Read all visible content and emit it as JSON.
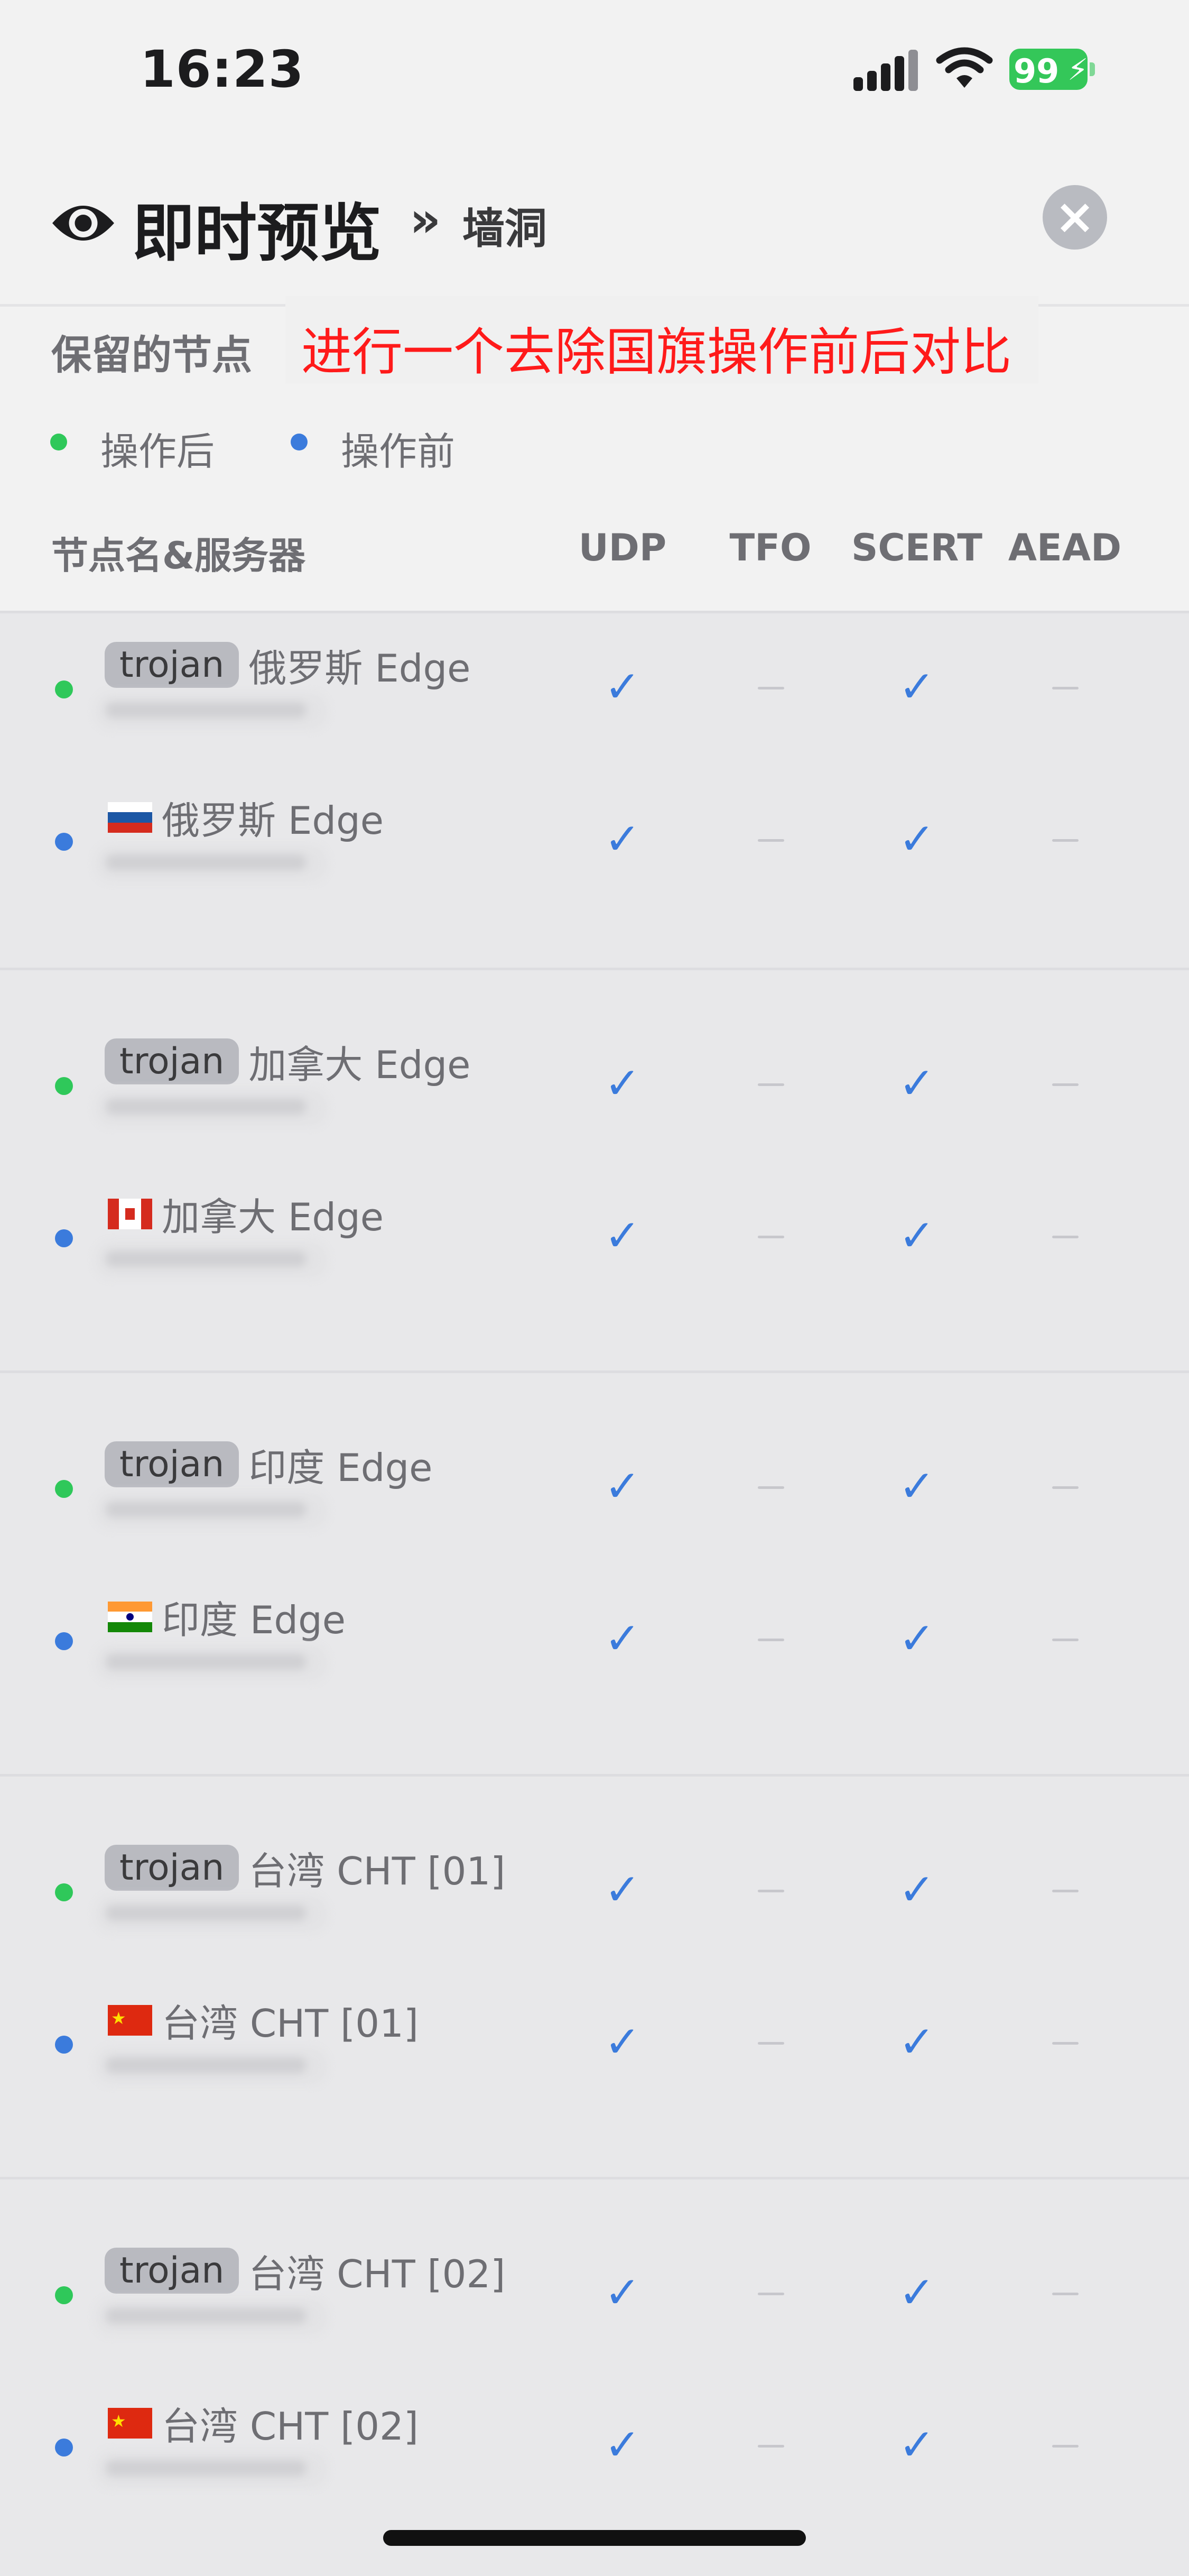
{
  "status_bar": {
    "time": "16:23",
    "battery": "99"
  },
  "header": {
    "title": "即时预览",
    "subtitle": "墙洞",
    "close_label": "×"
  },
  "section": {
    "title": "保留的节点",
    "annotation": "进行一个去除国旗操作前后对比"
  },
  "legend": {
    "after_label": "操作后",
    "after_color": "#2fc85a",
    "before_label": "操作前",
    "before_color": "#3b7bdc"
  },
  "columns": {
    "name_server": "节点名&服务器",
    "udp": "UDP",
    "tfo": "TFO",
    "scert": "SCERT",
    "aead": "AEAD"
  },
  "groups": [
    {
      "after": {
        "tag": "trojan",
        "name": "俄罗斯 Edge",
        "udp": true,
        "tfo": false,
        "scert": true,
        "aead": false
      },
      "before": {
        "flag": "ru-flag-icon",
        "name": "俄罗斯 Edge",
        "udp": true,
        "tfo": false,
        "scert": true,
        "aead": false
      }
    },
    {
      "after": {
        "tag": "trojan",
        "name": "加拿大 Edge",
        "udp": true,
        "tfo": false,
        "scert": true,
        "aead": false
      },
      "before": {
        "flag": "ca-flag-icon",
        "name": "加拿大 Edge",
        "udp": true,
        "tfo": false,
        "scert": true,
        "aead": false
      }
    },
    {
      "after": {
        "tag": "trojan",
        "name": "印度 Edge",
        "udp": true,
        "tfo": false,
        "scert": true,
        "aead": false
      },
      "before": {
        "flag": "in-flag-icon",
        "name": "印度 Edge",
        "udp": true,
        "tfo": false,
        "scert": true,
        "aead": false
      }
    },
    {
      "after": {
        "tag": "trojan",
        "name": "台湾 CHT [01]",
        "udp": true,
        "tfo": false,
        "scert": true,
        "aead": false
      },
      "before": {
        "flag": "cn-flag-icon",
        "name": "台湾 CHT [01]",
        "udp": true,
        "tfo": false,
        "scert": true,
        "aead": false
      }
    },
    {
      "after": {
        "tag": "trojan",
        "name": "台湾 CHT [02]",
        "udp": true,
        "tfo": false,
        "scert": true,
        "aead": false
      },
      "before": {
        "flag": "cn-flag-icon",
        "name": "台湾 CHT [02]",
        "udp": true,
        "tfo": false,
        "scert": true,
        "aead": false
      }
    }
  ]
}
